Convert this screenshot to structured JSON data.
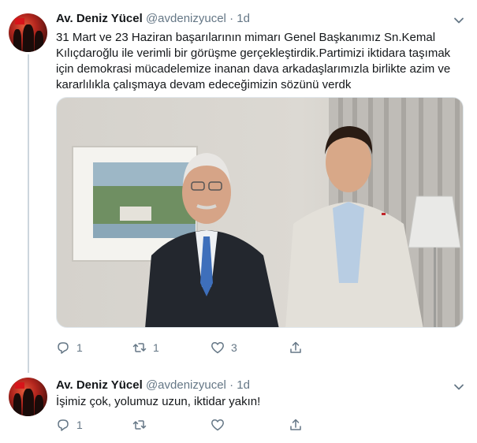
{
  "tweets": [
    {
      "author_name": "Av. Deniz Yücel",
      "handle": "@avdenizyucel",
      "separator": "·",
      "time": "1d",
      "text_lines": [
        "31 Mart ve 23 Haziran başarılarının mimarı Genel Başkanımız Sn.Kemal",
        "Kılıçdaroğlu ile verimli bir görüşme gerçekleştirdik.Partimizi iktidara taşımak",
        "için demokrasi mücadelemize inanan dava arkadaşlarımızla birlikte azim ve",
        "kararlılıkla çalışmaya devam edeceğimizin sözünü verdk"
      ],
      "reply_count": "1",
      "retweet_count": "1",
      "like_count": "3",
      "has_photo": true
    },
    {
      "author_name": "Av. Deniz Yücel",
      "handle": "@avdenizyucel",
      "separator": "·",
      "time": "1d",
      "text_lines": [
        "İşimiz çok, yolumuz uzun, iktidar yakın!"
      ],
      "reply_count": "1",
      "retweet_count": "",
      "like_count": "",
      "has_photo": false
    }
  ],
  "icons": {
    "reply": "reply-icon",
    "retweet": "retweet-icon",
    "like": "like-icon",
    "share": "share-icon",
    "menu": "chevron-down-icon"
  },
  "colors": {
    "text": "#14171a",
    "secondary": "#657786",
    "line": "#ccd6dd"
  }
}
